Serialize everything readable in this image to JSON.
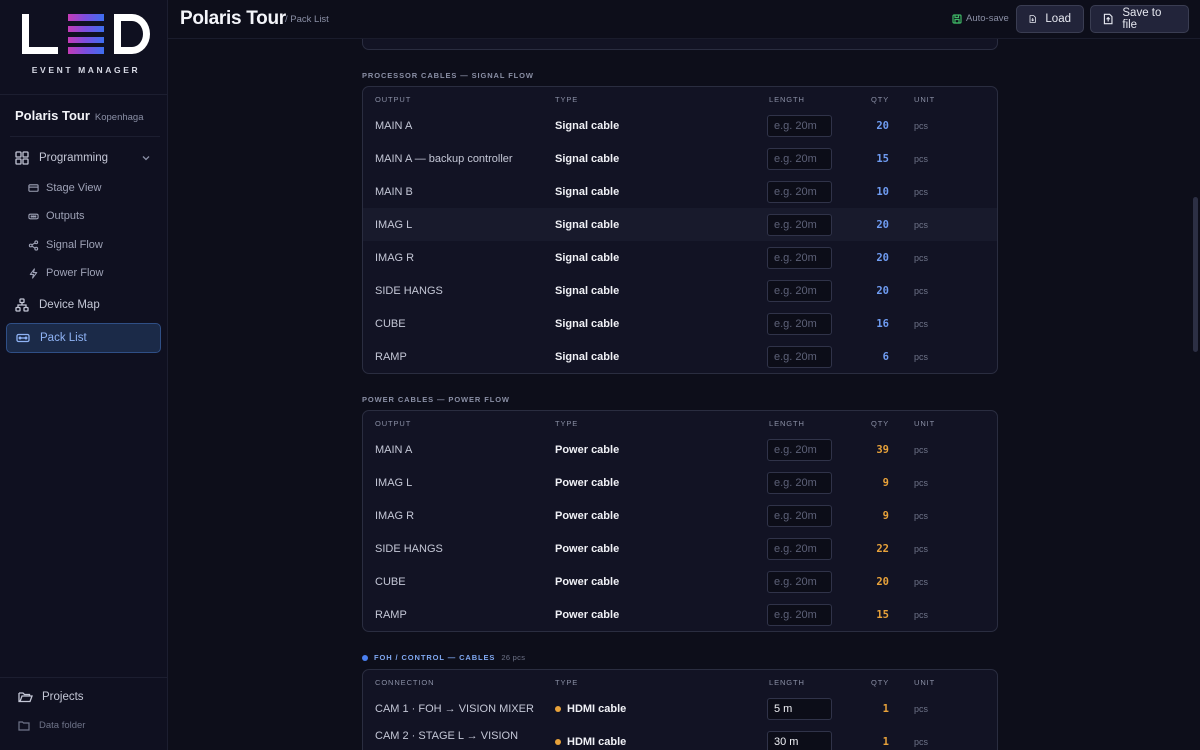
{
  "app": {
    "logo_subtitle": "EVENT MANAGER",
    "project_name": "Polaris Tour",
    "project_location": "Kopenhaga",
    "accent_color": "#4a7ff0"
  },
  "sidebar": {
    "programming": "Programming",
    "stage_view": "Stage View",
    "outputs": "Outputs",
    "signal_flow": "Signal Flow",
    "power_flow": "Power Flow",
    "device_map": "Device Map",
    "pack_list": "Pack List",
    "projects": "Projects",
    "data_folder": "Data folder"
  },
  "header": {
    "title": "Polaris Tour",
    "breadcrumb": "/ Pack List",
    "autosave": "Auto-save",
    "load": "Load",
    "save": "Save to file"
  },
  "sections": {
    "processor": {
      "title": "PROCESSOR CABLES — SIGNAL FLOW",
      "columns": [
        "OUTPUT",
        "TYPE",
        "LENGTH",
        "QTY",
        "UNIT"
      ],
      "rows": [
        {
          "output": "MAIN A",
          "type": "Signal cable",
          "length": "",
          "qty": "20",
          "unit": "pcs"
        },
        {
          "output": "MAIN A — backup controller",
          "type": "Signal cable",
          "length": "",
          "qty": "15",
          "unit": "pcs"
        },
        {
          "output": "MAIN B",
          "type": "Signal cable",
          "length": "",
          "qty": "10",
          "unit": "pcs"
        },
        {
          "output": "IMAG L",
          "type": "Signal cable",
          "length": "",
          "qty": "20",
          "unit": "pcs"
        },
        {
          "output": "IMAG R",
          "type": "Signal cable",
          "length": "",
          "qty": "20",
          "unit": "pcs"
        },
        {
          "output": "SIDE HANGS",
          "type": "Signal cable",
          "length": "",
          "qty": "20",
          "unit": "pcs"
        },
        {
          "output": "CUBE",
          "type": "Signal cable",
          "length": "",
          "qty": "16",
          "unit": "pcs"
        },
        {
          "output": "RAMP",
          "type": "Signal cable",
          "length": "",
          "qty": "6",
          "unit": "pcs"
        }
      ]
    },
    "power": {
      "title": "POWER CABLES — POWER FLOW",
      "columns": [
        "OUTPUT",
        "TYPE",
        "LENGTH",
        "QTY",
        "UNIT"
      ],
      "rows": [
        {
          "output": "MAIN A",
          "type": "Power cable",
          "length": "",
          "qty": "39",
          "unit": "pcs"
        },
        {
          "output": "IMAG L",
          "type": "Power cable",
          "length": "",
          "qty": "9",
          "unit": "pcs"
        },
        {
          "output": "IMAG R",
          "type": "Power cable",
          "length": "",
          "qty": "9",
          "unit": "pcs"
        },
        {
          "output": "SIDE HANGS",
          "type": "Power cable",
          "length": "",
          "qty": "22",
          "unit": "pcs"
        },
        {
          "output": "CUBE",
          "type": "Power cable",
          "length": "",
          "qty": "20",
          "unit": "pcs"
        },
        {
          "output": "RAMP",
          "type": "Power cable",
          "length": "",
          "qty": "15",
          "unit": "pcs"
        }
      ]
    },
    "foh": {
      "title": "FOH / CONTROL — CABLES",
      "count": "26 pcs",
      "columns": [
        "CONNECTION",
        "TYPE",
        "LENGTH",
        "QTY",
        "UNIT"
      ],
      "rows": [
        {
          "output": "CAM 1 · FOH → VISION MIXER",
          "type": "HDMI cable",
          "length": "5 m",
          "qty": "1",
          "unit": "pcs"
        },
        {
          "output": "CAM 2 · STAGE L → VISION",
          "type": "HDMI cable",
          "length": "30 m",
          "qty": "1",
          "unit": "pcs"
        }
      ]
    }
  },
  "length_placeholder": "e.g. 20m"
}
